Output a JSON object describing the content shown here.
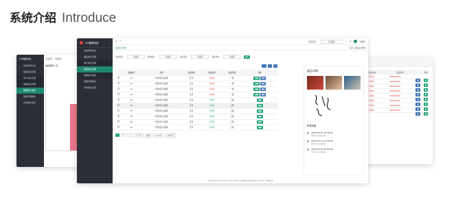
{
  "header": {
    "title_zh": "系统介绍",
    "title_en": "Introduce"
  },
  "app": {
    "name": "ICH数据系统",
    "page_title": "展品信息管理",
    "breadcrumb": "首页 / 展品信息管理",
    "footer": "Intelligent City Heritage System(ICHS) 河北雅颂信息科技有限公司 2020 © 版权所有"
  },
  "sidebar": {
    "items": [
      "系统登录状态",
      "展品信息管理",
      "用户信息管理",
      "展馆信息管理",
      "数据统计报告",
      "数据管理维护",
      "系统相关设置"
    ]
  },
  "left_window": {
    "tabs": [
      "分类排行",
      "分类排行"
    ],
    "chart_title": "展品数量一览",
    "sidebar_items": [
      "系统登录状态",
      "展品信息管理",
      "用户信息管理",
      "展馆信息管理",
      "数据统计报告",
      "数据管理维护",
      "系统相关设置"
    ]
  },
  "filters": {
    "labels": [
      "分类名称：",
      "所属展馆：",
      "展品等级：",
      "展品状态："
    ],
    "value": "请选择",
    "search": "搜索"
  },
  "topbar": {
    "select_label": "展馆选择：",
    "select_value": "全部展馆",
    "user": "管理员"
  },
  "table": {
    "headers": [
      "",
      "展品编号",
      "名称",
      "展品类别",
      "展品状态",
      "展品等级",
      "操作"
    ],
    "rows": [
      [
        "",
        "01",
        "鸟兽纹瓦当(战国)",
        "瓦当",
        "待审核",
        "一级",
        ""
      ],
      [
        "",
        "02",
        "鸟兽纹瓦当(战国)",
        "瓦当",
        "待审核",
        "一级",
        ""
      ],
      [
        "",
        "03",
        "鸟兽纹瓦当(战国)",
        "瓦当",
        "待审核",
        "一级",
        ""
      ],
      [
        "",
        "04",
        "鸟兽纹瓦当(战国)",
        "瓦当",
        "待审核",
        "一级",
        ""
      ],
      [
        "",
        "05",
        "鸟兽纹瓦当(战国)",
        "瓦当",
        "已审核",
        "三级",
        ""
      ],
      [
        "",
        "06",
        "鸟兽纹瓦当(战国)",
        "瓦当",
        "已审核",
        "三级",
        ""
      ],
      [
        "",
        "07",
        "鸟兽纹瓦当(战国)",
        "瓦当",
        "已审核",
        "三级",
        ""
      ],
      [
        "",
        "08",
        "鸟兽纹瓦当(战国)",
        "瓦当",
        "已审核",
        "三级",
        ""
      ],
      [
        "",
        "09",
        "鸟兽纹瓦当(战国)",
        "瓦当",
        "已审核",
        "三级",
        ""
      ],
      [
        "",
        "10",
        "鸟兽纹瓦当(战国)",
        "瓦当",
        "已审核",
        "三级",
        ""
      ]
    ],
    "status_colors": [
      "red",
      "red",
      "red",
      "red",
      "grn",
      "grn",
      "grn",
      "grn",
      "grn",
      "grn"
    ],
    "pager": {
      "pages": [
        "1",
        "2",
        "3"
      ],
      "next": "下一页",
      "jump": "跳转",
      "total": "共10条",
      "size": "10条/页"
    }
  },
  "detail": {
    "title": "展品详情",
    "section": "审核进度",
    "timeline": [
      {
        "time": "2020-04-10 16:10:09",
        "desc": "审核人员已提交审核"
      },
      {
        "time": "2019-12-19 14:30:03",
        "desc": "审核人员已提交审核"
      },
      {
        "time": "2019-12-09 09:00:00",
        "desc": "审核人员已提交审核"
      }
    ]
  },
  "right_window": {
    "headers": [
      "展品状态",
      "展品名称",
      "操作"
    ],
    "rows": [
      "待审核",
      "待审核",
      "待审核",
      "待审核",
      "待审核",
      "待审核",
      "待审核",
      "待审核"
    ]
  },
  "colors": {
    "accent": "#1f8a70",
    "sidebar": "#2b2e36",
    "danger": "#e0443e",
    "success": "#17a567"
  }
}
